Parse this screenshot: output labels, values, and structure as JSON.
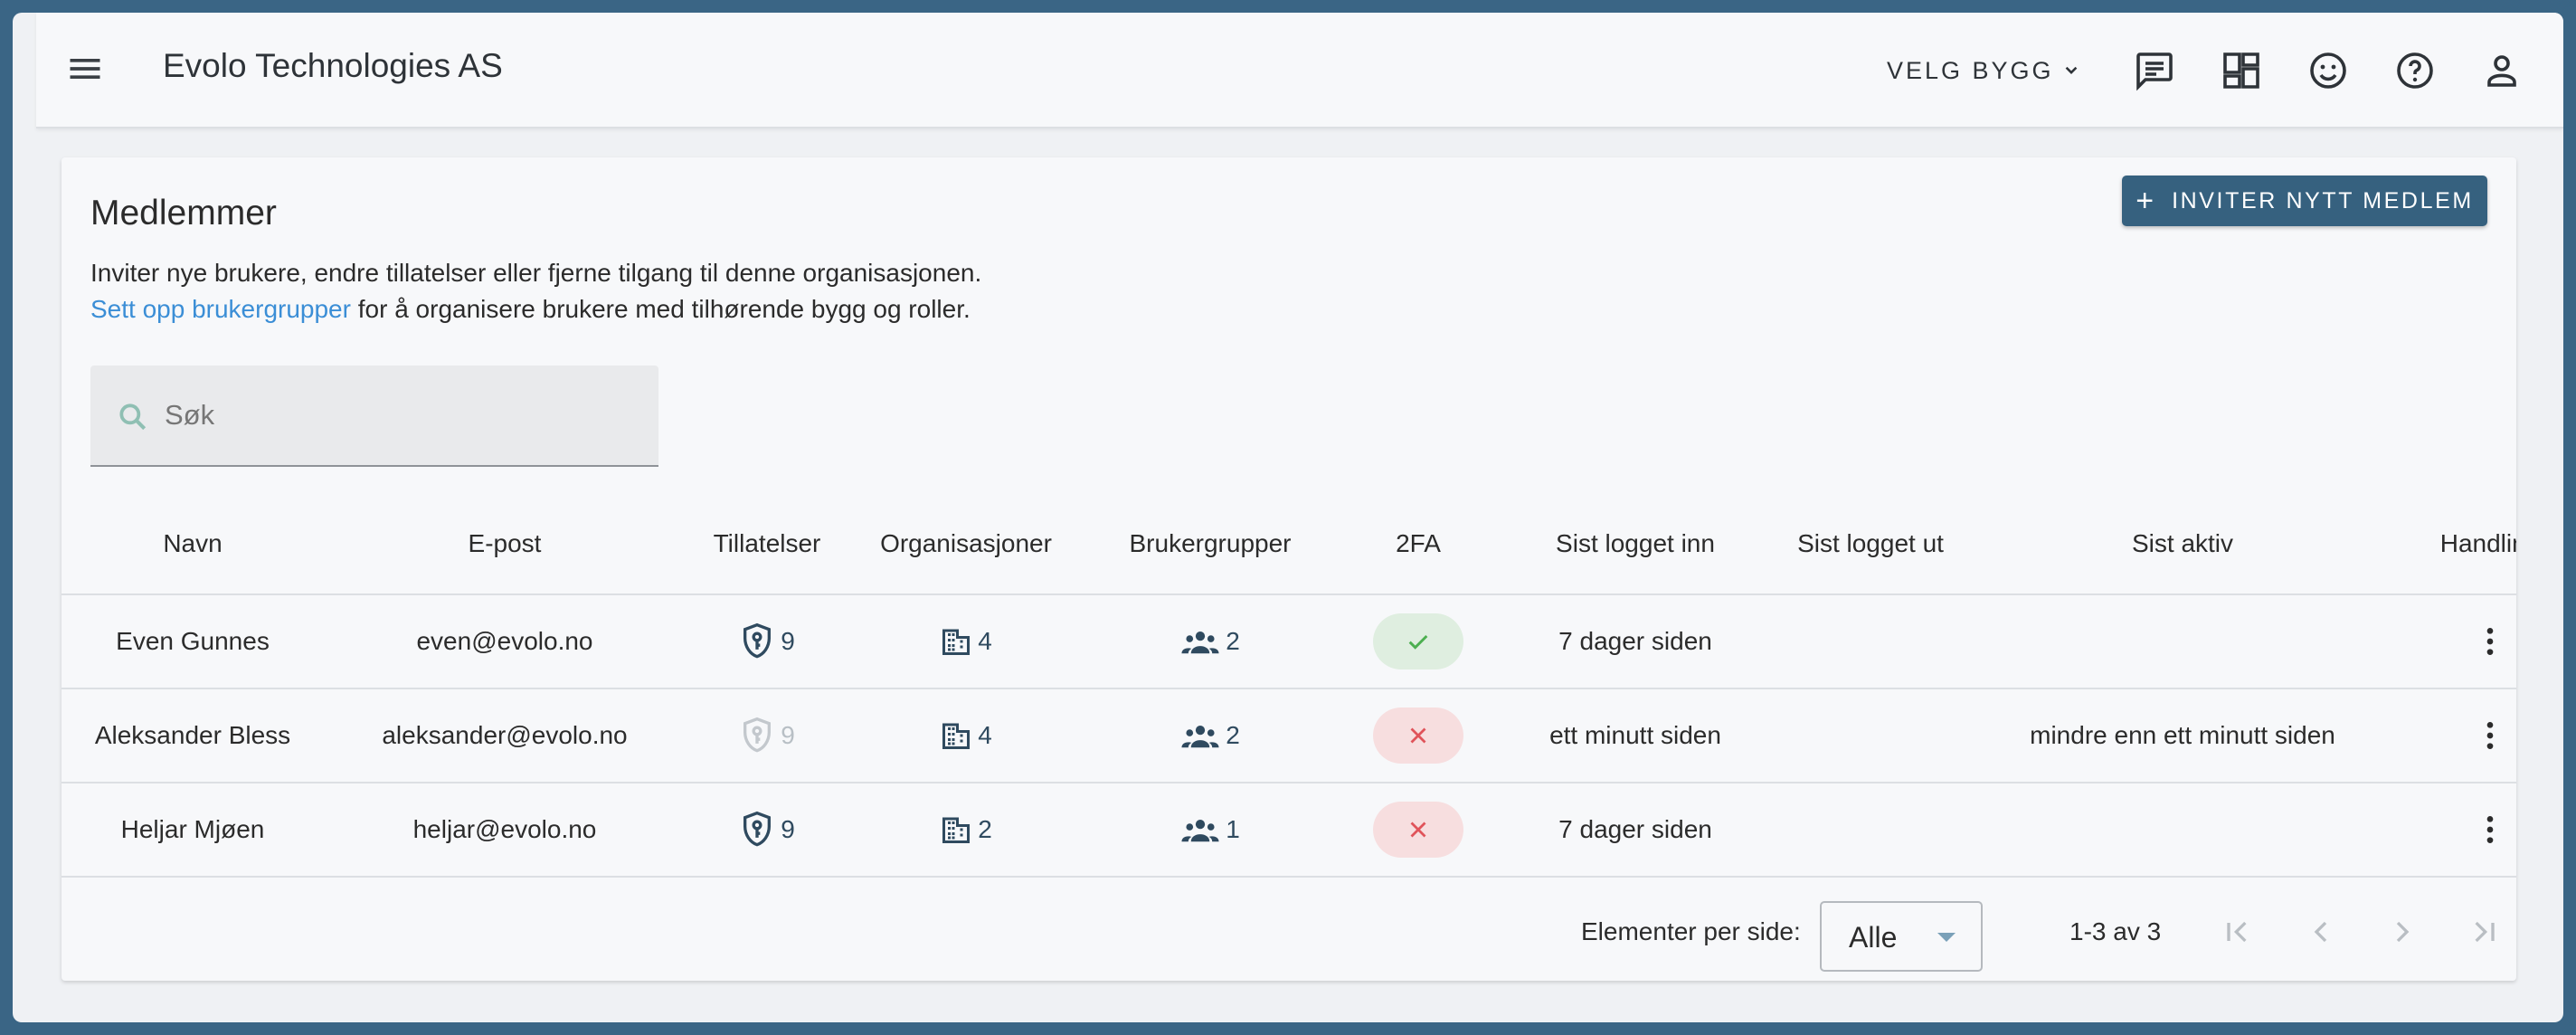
{
  "header": {
    "company": "Evolo Technologies AS",
    "building_select": "VELG BYGG"
  },
  "members": {
    "title": "Medlemmer",
    "invite_button": "INVITER NYTT MEDLEM",
    "description_line1": "Inviter nye brukere, endre tillatelser eller fjerne tilgang til denne organisasjonen.",
    "link_text": "Sett opp brukergrupper",
    "description_line2_rest": " for å organisere brukere med tilhørende bygg og roller.",
    "search_placeholder": "Søk"
  },
  "table": {
    "columns": [
      "Navn",
      "E-post",
      "Tillatelser",
      "Organisasjoner",
      "Brukergrupper",
      "2FA",
      "Sist logget inn",
      "Sist logget ut",
      "Sist aktiv",
      "Handling"
    ],
    "rows": [
      {
        "name": "Even Gunnes",
        "email": "even@evolo.no",
        "permissions": "9",
        "permissions_active": true,
        "organizations": "4",
        "groups": "2",
        "twofa": true,
        "last_login": "7 dager siden",
        "last_logout": "",
        "last_active": ""
      },
      {
        "name": "Aleksander Bless",
        "email": "aleksander@evolo.no",
        "permissions": "9",
        "permissions_active": false,
        "organizations": "4",
        "groups": "2",
        "twofa": false,
        "last_login": "ett minutt siden",
        "last_logout": "",
        "last_active": "mindre enn ett minutt siden"
      },
      {
        "name": "Heljar Mjøen",
        "email": "heljar@evolo.no",
        "permissions": "9",
        "permissions_active": true,
        "organizations": "2",
        "groups": "1",
        "twofa": false,
        "last_login": "7 dager siden",
        "last_logout": "",
        "last_active": ""
      }
    ]
  },
  "pagination": {
    "per_page_label": "Elementer per side:",
    "per_page_value": "Alle",
    "range": "1-3 av 3"
  },
  "colors": {
    "frame": "#3a6585",
    "primary_button": "#36617f",
    "link": "#3b8ed6",
    "success_bg": "#dfeee0",
    "success_icon": "#4caf50",
    "error_bg": "#f7dedf",
    "error_icon": "#e0535a"
  },
  "icons": [
    "menu-icon",
    "chat-icon",
    "dashboard-icon",
    "smiley-icon",
    "help-icon",
    "account-icon",
    "search-icon",
    "shield-key-icon",
    "building-icon",
    "group-icon",
    "check-icon",
    "close-icon",
    "more-vert-icon",
    "first-page-icon",
    "prev-page-icon",
    "next-page-icon",
    "last-page-icon",
    "chevron-down-icon"
  ]
}
